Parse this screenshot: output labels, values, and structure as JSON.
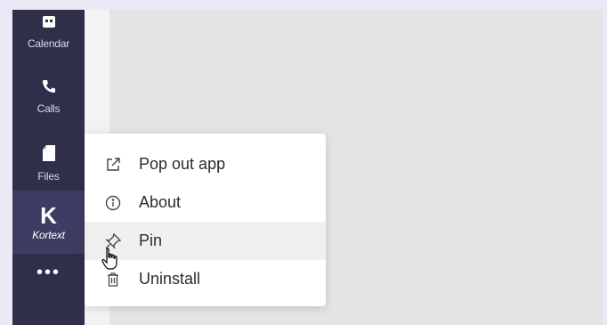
{
  "sidebar": {
    "items": [
      {
        "label": "Calendar",
        "icon": "calendar-icon"
      },
      {
        "label": "Calls",
        "icon": "phone-icon"
      },
      {
        "label": "Files",
        "icon": "file-icon"
      },
      {
        "label": "Kortext",
        "logo": "K",
        "icon": "kortext-logo",
        "active": true
      }
    ],
    "more_label": "•••"
  },
  "context_menu": {
    "items": [
      {
        "label": "Pop out app",
        "icon": "pop-out-icon"
      },
      {
        "label": "About",
        "icon": "info-icon"
      },
      {
        "label": "Pin",
        "icon": "pin-icon",
        "hovered": true
      },
      {
        "label": "Uninstall",
        "icon": "trash-icon"
      }
    ]
  },
  "colors": {
    "rail": "#2f2f4a",
    "rail_active": "#3d3d63",
    "background": "#ece8f6"
  }
}
